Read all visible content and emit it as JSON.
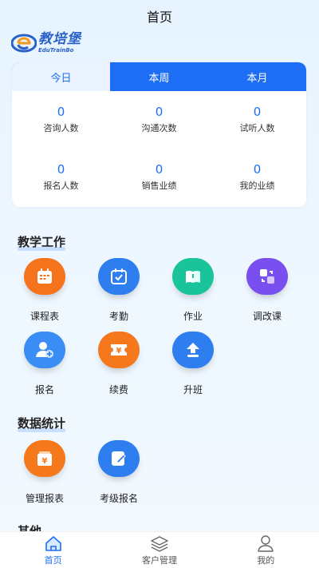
{
  "header": {
    "title": "首页"
  },
  "logo": {
    "cn": "教培堡",
    "en": "EduTrainBo"
  },
  "stats": {
    "tabs": [
      {
        "label": "今日",
        "active": true
      },
      {
        "label": "本周",
        "active": false
      },
      {
        "label": "本月",
        "active": false
      }
    ],
    "items": [
      {
        "value": "0",
        "label": "咨询人数"
      },
      {
        "value": "0",
        "label": "沟通次数"
      },
      {
        "value": "0",
        "label": "试听人数"
      },
      {
        "value": "0",
        "label": "报名人数"
      },
      {
        "value": "0",
        "label": "销售业绩"
      },
      {
        "value": "0",
        "label": "我的业绩"
      }
    ]
  },
  "teaching": {
    "title": "教学工作",
    "items": [
      {
        "label": "课程表",
        "icon": "calendar-icon",
        "color": "#f5731d"
      },
      {
        "label": "考勤",
        "icon": "attendance-icon",
        "color": "#2f7ef0"
      },
      {
        "label": "作业",
        "icon": "book-icon",
        "color": "#19c49a"
      },
      {
        "label": "调改课",
        "icon": "swap-icon",
        "color": "#7a4ff0"
      },
      {
        "label": "报名",
        "icon": "add-user-icon",
        "color": "#3a8df5"
      },
      {
        "label": "续费",
        "icon": "ticket-icon",
        "color": "#f5781c"
      },
      {
        "label": "升班",
        "icon": "upgrade-icon",
        "color": "#2f7ef0"
      }
    ]
  },
  "statistics": {
    "title": "数据统计",
    "items": [
      {
        "label": "管理报表",
        "icon": "report-icon",
        "color": "#f5781c"
      },
      {
        "label": "考级报名",
        "icon": "edit-icon",
        "color": "#2f7ef0"
      }
    ]
  },
  "other": {
    "title": "其他"
  },
  "tabbar": {
    "items": [
      {
        "label": "首页",
        "icon": "home-icon",
        "active": true
      },
      {
        "label": "客户管理",
        "icon": "layers-icon",
        "active": false
      },
      {
        "label": "我的",
        "icon": "user-icon",
        "active": false
      }
    ]
  },
  "colors": {
    "primary": "#1e6ef5"
  }
}
